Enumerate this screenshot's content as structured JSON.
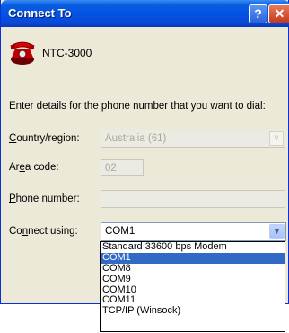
{
  "window": {
    "title": "Connect To"
  },
  "titlebar": {
    "help_label": "?",
    "close_label": "✕"
  },
  "connection": {
    "name": "NTC-3000",
    "icon": "phone-icon"
  },
  "instructions": "Enter details for the phone number that you want to dial:",
  "fields": {
    "country": {
      "label_pre": "",
      "label_ul": "C",
      "label_post": "ountry/region:",
      "value": "Australia (61)"
    },
    "area": {
      "label_pre": "Ar",
      "label_ul": "e",
      "label_post": "a code:",
      "value": "02"
    },
    "phone": {
      "label_pre": "",
      "label_ul": "P",
      "label_post": "hone number:",
      "value": ""
    },
    "connect": {
      "label_pre": "Co",
      "label_ul": "n",
      "label_post": "nect using:",
      "value": "COM1"
    }
  },
  "dropdown": {
    "options": [
      "Standard 33600 bps Modem",
      "COM1",
      "COM8",
      "COM9",
      "COM10",
      "COM11",
      "TCP/IP (Winsock)"
    ],
    "selected_index": 1
  },
  "colors": {
    "titlebar": "#0054e3",
    "selection": "#316ac5",
    "dialog_bg": "#ece9d8"
  }
}
